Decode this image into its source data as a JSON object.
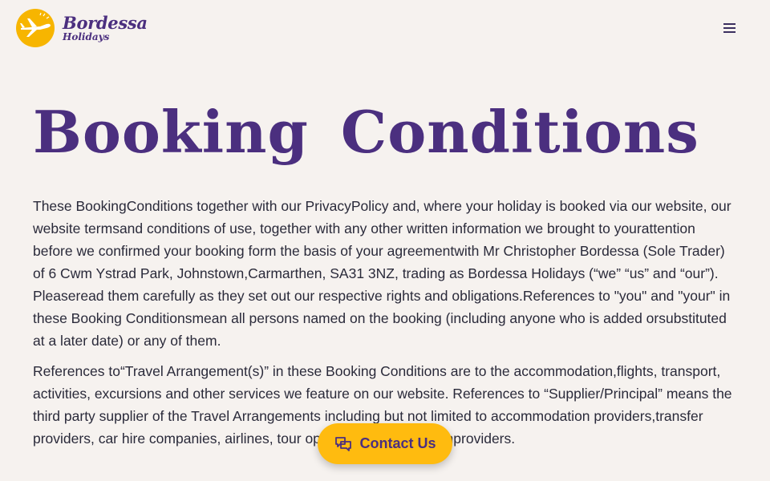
{
  "header": {
    "logo_name": "Bordessa",
    "logo_sub": "Holidays",
    "menu_icon": "hamburger-menu-icon"
  },
  "main": {
    "title": "Booking Conditions",
    "paragraphs": [
      "These BookingConditions together with our PrivacyPolicy and, where your holiday is booked via our website, our website termsand conditions of use, together with any other written information we brought to yourattention before we confirmed your booking form the basis of your agreementwith Mr Christopher Bordessa (Sole Trader) of 6 Cwm Ystrad Park, Johnstown,Carmarthen, SA31 3NZ, trading as Bordessa Holidays (“we” “us” and “our”). Pleaseread them carefully as they set out our respective rights and obligations.References to \"you\" and \"your\" in these Booking Conditionsmean all persons named on the booking (including anyone who is added orsubstituted at a later date) or any of them.",
      "References to“Travel Arrangement(s)” in these Booking Conditions are to the accommodation,flights, transport, activities, excursions and other services we feature on our website. References to “Supplier/Principal” means the third party supplier of the Travel Arrangements including but not limited to accommodation providers,transfer providers, car hire companies, airlines, tour operators and attractionproviders."
    ]
  },
  "contact": {
    "label": "Contact Us",
    "icon": "chat-bubbles-icon"
  },
  "colors": {
    "background": "#f6f2ef",
    "brand_purple": "#4b2f7f",
    "accent_yellow": "#ffbb0f",
    "body_text": "#2a2a3a"
  }
}
